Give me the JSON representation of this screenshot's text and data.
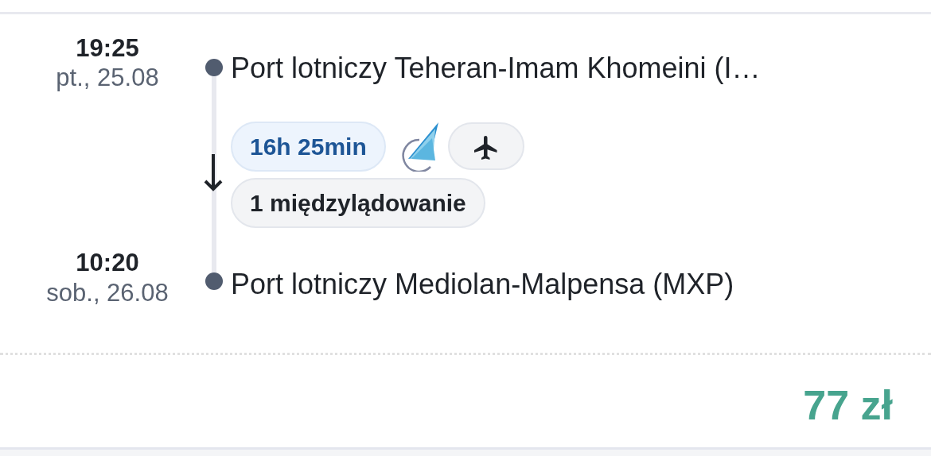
{
  "departure": {
    "time": "19:25",
    "date": "pt., 25.08",
    "airport": "Port lotniczy Teheran-Imam Khomeini (I…"
  },
  "duration": "16h 25min",
  "stops": "1 międzylądowanie",
  "arrival": {
    "time": "10:20",
    "date": "sob., 26.08",
    "airport": "Port lotniczy Mediolan-Malpensa (MXP)"
  },
  "price": "77 zł"
}
